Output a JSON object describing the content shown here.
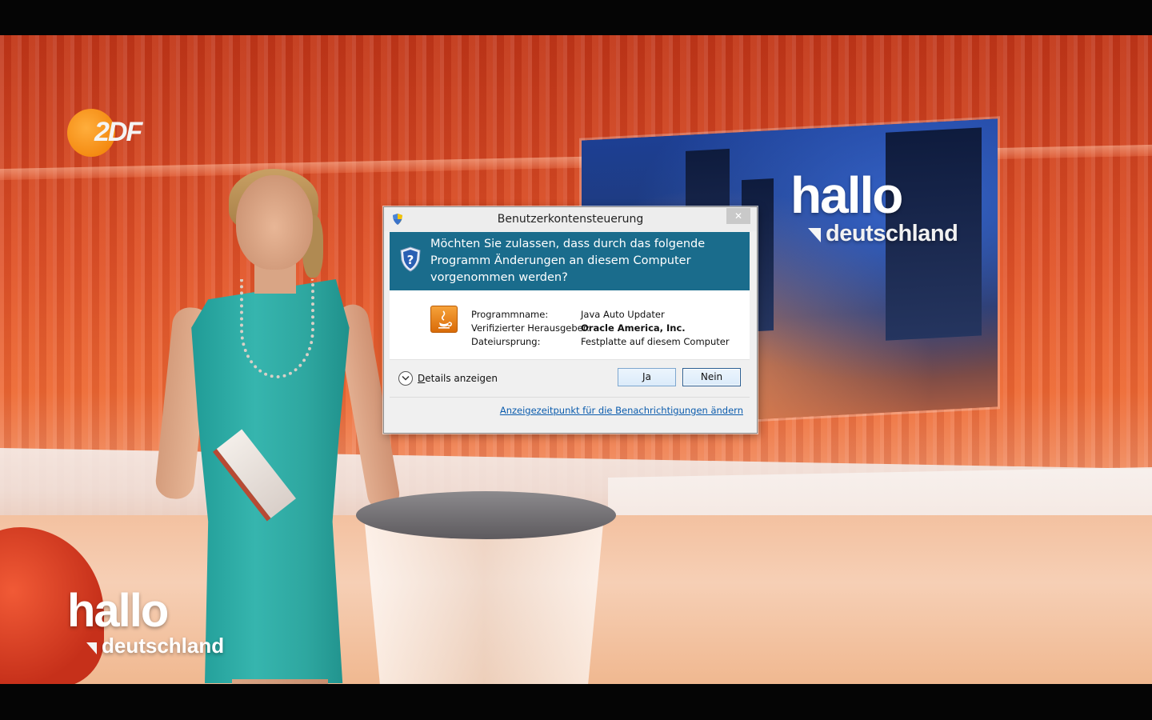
{
  "broadcast": {
    "channel_logo": "2DF",
    "screen_logo_main": "hallo",
    "screen_logo_sub": "deutschland",
    "corner_logo_main": "hallo",
    "corner_logo_sub": "deutschland"
  },
  "dialog": {
    "title": "Benutzerkontensteuerung",
    "close_symbol": "✕",
    "question": "Möchten Sie zulassen, dass durch das folgende Programm Änderungen an diesem Computer vorgenommen werden?",
    "program_icon": "java-icon",
    "fields": {
      "program_label": "Programmname:",
      "program_value": "Java Auto Updater",
      "publisher_label": "Verifizierter Herausgeber:",
      "publisher_value": "Oracle America, Inc.",
      "origin_label": "Dateiursprung:",
      "origin_value": "Festplatte auf diesem Computer"
    },
    "details_label": "Details anzeigen",
    "yes_label": "Ja",
    "no_label": "Nein",
    "notification_link": "Anzeigezeitpunkt für die Benachrichtigungen ändern"
  },
  "colors": {
    "banner": "#1a6c8c",
    "dialog_bg": "#f0f0f0",
    "link": "#0b5cad",
    "zdf_orange": "#f07c00",
    "dress": "#2ea7a0"
  }
}
